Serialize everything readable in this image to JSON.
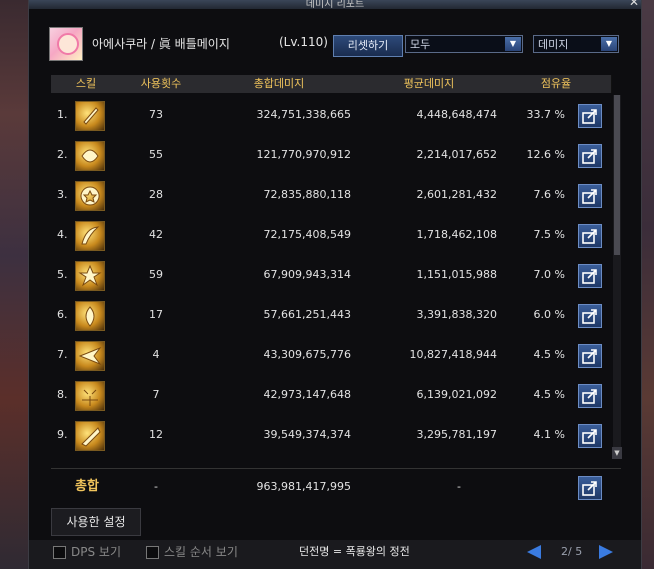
{
  "window": {
    "title": "데미지 리포트"
  },
  "header": {
    "character_name": "아에사쿠라 / 眞 배틀메이지",
    "level": "(Lv.110)",
    "reset_label": "리셋하기",
    "filter_value": "모두",
    "metric_value": "데미지"
  },
  "table": {
    "columns": [
      "스킬",
      "사용횟수",
      "총합데미지",
      "평균데미지",
      "점유율"
    ],
    "rows": [
      {
        "rank": "1.",
        "uses": "73",
        "total": "324,751,338,665",
        "avg": "4,448,648,474",
        "share": "33.7 %"
      },
      {
        "rank": "2.",
        "uses": "55",
        "total": "121,770,970,912",
        "avg": "2,214,017,652",
        "share": "12.6 %"
      },
      {
        "rank": "3.",
        "uses": "28",
        "total": "72,835,880,118",
        "avg": "2,601,281,432",
        "share": "7.6 %"
      },
      {
        "rank": "4.",
        "uses": "42",
        "total": "72,175,408,549",
        "avg": "1,718,462,108",
        "share": "7.5 %"
      },
      {
        "rank": "5.",
        "uses": "59",
        "total": "67,909,943,314",
        "avg": "1,151,015,988",
        "share": "7.0 %"
      },
      {
        "rank": "6.",
        "uses": "17",
        "total": "57,661,251,443",
        "avg": "3,391,838,320",
        "share": "6.0 %"
      },
      {
        "rank": "7.",
        "uses": "4",
        "total": "43,309,675,776",
        "avg": "10,827,418,944",
        "share": "4.5 %"
      },
      {
        "rank": "8.",
        "uses": "7",
        "total": "42,973,147,648",
        "avg": "6,139,021,092",
        "share": "4.5 %"
      },
      {
        "rank": "9.",
        "uses": "12",
        "total": "39,549,374,374",
        "avg": "3,295,781,197",
        "share": "4.1 %"
      }
    ],
    "total": {
      "label": "총합",
      "uses": "-",
      "total": "963,981,417,995",
      "avg": "-"
    }
  },
  "tabs": {
    "used_settings": "사용한 설정"
  },
  "footer": {
    "dps_label": "DPS 보기",
    "skill_order_label": "스킬 순서 보기",
    "dungeon": "던전명 = 폭룡왕의 정전",
    "page": "2/ 5"
  },
  "colors": {
    "accent": "#f0c45c",
    "button": "#2d4a7a",
    "pager": "#3a7be0"
  }
}
